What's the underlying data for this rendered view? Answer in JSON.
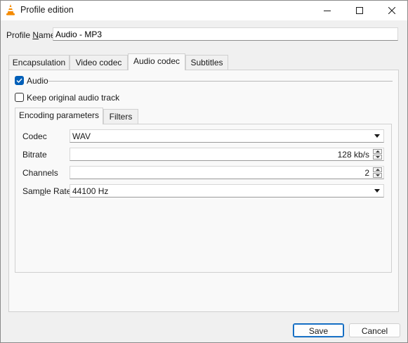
{
  "window": {
    "title": "Profile edition",
    "controls": {
      "minimize": "minimize",
      "maximize": "maximize",
      "close": "close"
    }
  },
  "profile": {
    "label_pre": "Profile ",
    "label_accel": "N",
    "label_post": "ame",
    "value": "Audio - MP3"
  },
  "tabs": [
    {
      "label": "Encapsulation",
      "active": false
    },
    {
      "label": "Video codec",
      "active": false
    },
    {
      "label": "Audio codec",
      "active": true
    },
    {
      "label": "Subtitles",
      "active": false
    }
  ],
  "audio": {
    "enabled_label": "Audio",
    "enabled": true,
    "keep_original_label": "Keep original audio track",
    "keep_original": false
  },
  "subtabs": [
    {
      "label": "Encoding parameters",
      "active": true
    },
    {
      "label": "Filters",
      "active": false
    }
  ],
  "params": {
    "codec": {
      "label": "Codec",
      "value": "WAV"
    },
    "bitrate": {
      "label": "Bitrate",
      "value": "128 kb/s"
    },
    "channels": {
      "label": "Channels",
      "value": "2"
    },
    "sample_rate": {
      "label_pre": "Sam",
      "label_accel": "p",
      "label_post": "le Rate",
      "value": "44100 Hz"
    }
  },
  "buttons": {
    "save": "Save",
    "cancel": "Cancel"
  },
  "colors": {
    "accent": "#005fb8",
    "window_bg": "#f0f0f0",
    "panel_bg": "#f9f9f9"
  }
}
